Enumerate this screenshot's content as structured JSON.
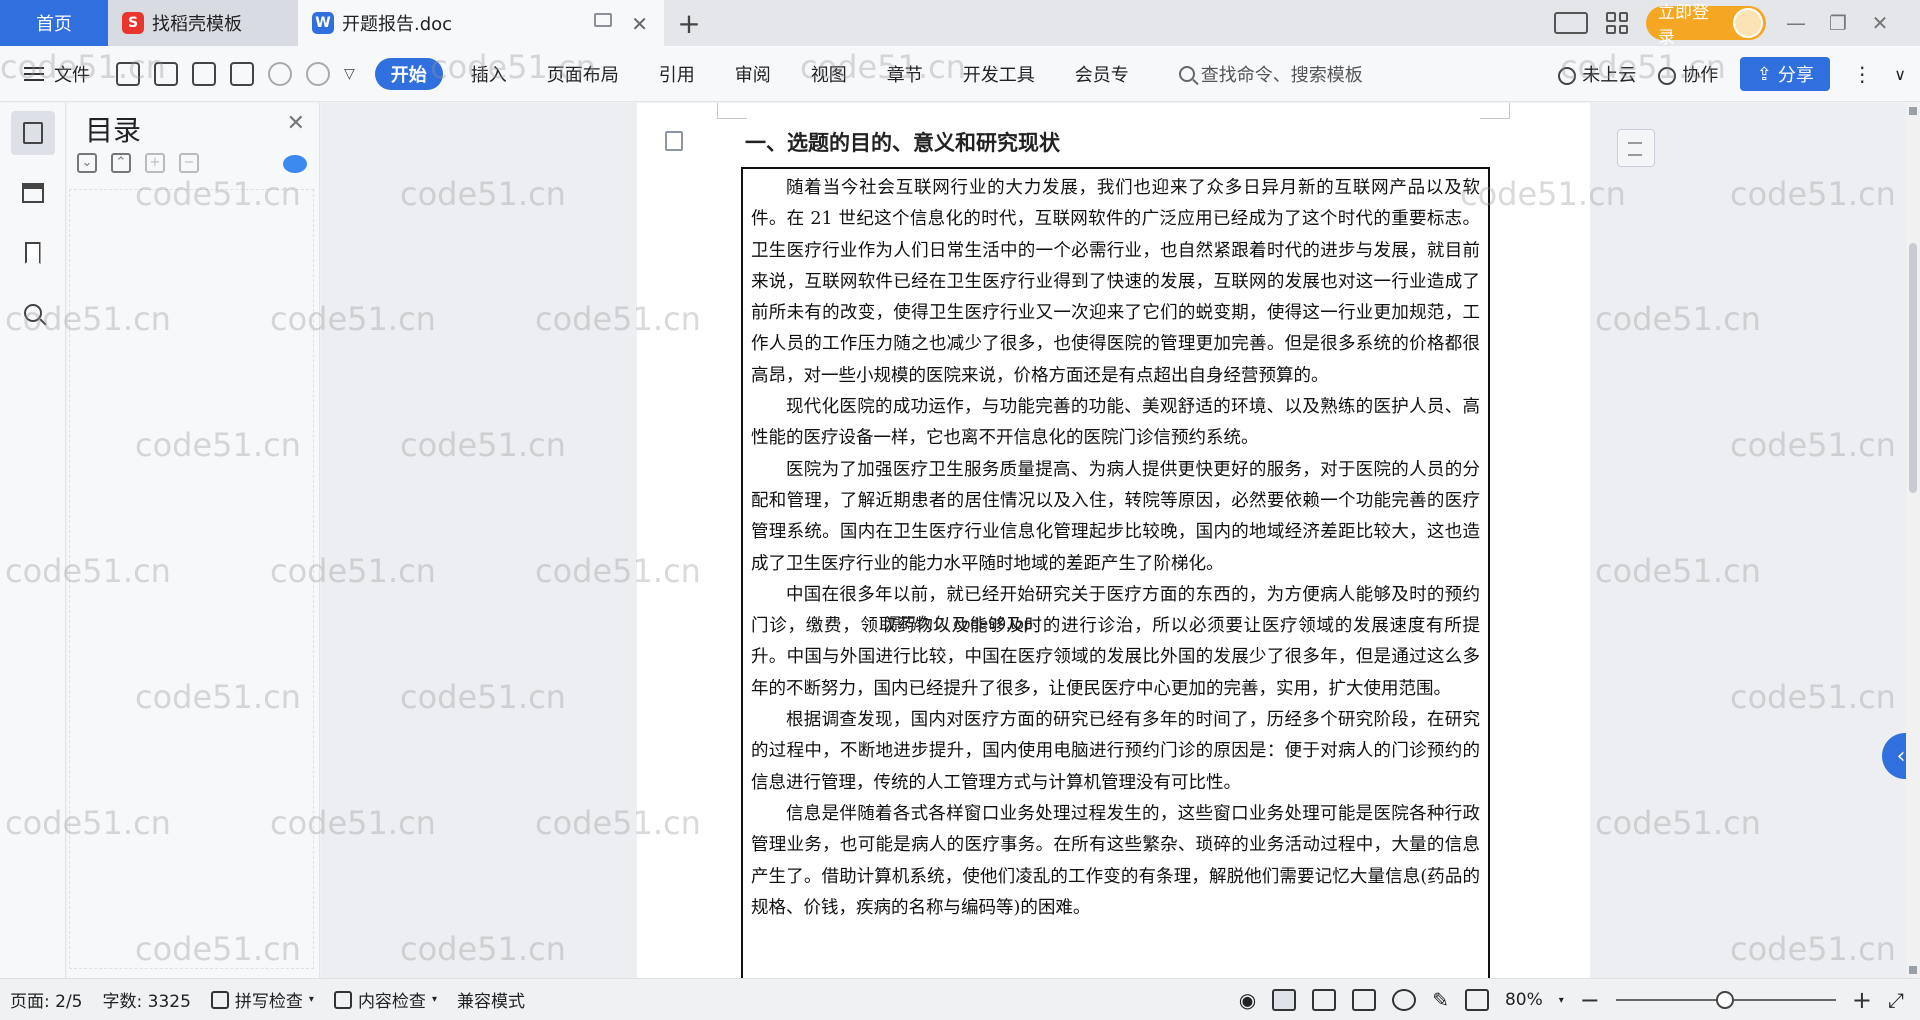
{
  "tabs": {
    "home": "首页",
    "templates": "找稻壳模板",
    "document": "开题报告.doc",
    "login": "立即登录"
  },
  "menu": {
    "file": "文件",
    "ribbon": [
      "开始",
      "插入",
      "页面布局",
      "引用",
      "审阅",
      "视图",
      "章节",
      "开发工具",
      "会员专"
    ],
    "search_placeholder": "查找命令、搜索模板",
    "cloud": "未上云",
    "collab": "协作",
    "share": "分享"
  },
  "toc": {
    "title": "目录"
  },
  "document": {
    "heading": "一、选题的目的、意义和研究现状",
    "paragraphs": [
      "随着当今社会互联网行业的大力发展，我们也迎来了众多日异月新的互联网产品以及软件。在 21 世纪这个信息化的时代，互联网软件的广泛应用已经成为了这个时代的重要标志。卫生医疗行业作为人们日常生活中的一个必需行业，也自然紧跟着时代的进步与发展，就目前来说，互联网软件已经在卫生医疗行业得到了快速的发展，互联网的发展也对这一行业造成了前所未有的改变，使得卫生医疗行业又一次迎来了它们的蜕变期，使得这一行业更加规范，工作人员的工作压力随之也减少了很多，也使得医院的管理更加完善。但是很多系统的价格都很高昂，对一些小规模的医院来说，价格方面还是有点超出自身经营预算的。",
      "现代化医院的成功运作，与功能完善的功能、美观舒适的环境、以及熟练的医护人员、高性能的医疗设备一样，它也离不开信息化的医院门诊信预约系统。",
      "医院为了加强医疗卫生服务质量提高、为病人提供更快更好的服务，对于医院的人员的分配和管理，了解近期患者的居住情况以及入住，转院等原因，必然要依赖一个功能完善的医疗管理系统。国内在卫生医疗行业信息化管理起步比较晚，国内的地域经济差距比较大，这也造成了卫生医疗行业的能力水平随时地域的差距产生了阶梯化。",
      "中国在很多年以前，就已经开始研究关于医疗方面的东西的，为方便病人能够及时的预约门诊，缴费，领取药物以及能够及时的进行诊治，所以必须要让医疗领域的发展速度有所提升。中国与外国进行比较，中国在医疗领域的发展比外国的发展少了很多年，但是通过这么多年的不断努力，国内已经提升了很多，让便民医疗中心更加的完善，实用，扩大使用范围。",
      "根据调查发现，国内对医疗方面的研究已经有多年的时间了，历经多个研究阶段，在研究的过程中，不断地进步提升，国内使用电脑进行预约门诊的原因是：便于对病人的门诊预约的信息进行管理，传统的人工管理方式与计算机管理没有可比性。",
      "信息是伴随着各式各样窗口业务处理过程发生的，这些窗口业务处理可能是医院各种行政管理业务，也可能是病人的医疗事务。在所有这些繁杂、琐碎的业务活动过程中，大量的信息产生了。借助计算机系统，使他们凌乱的工作变的有条理，解脱他们需要记忆大量信息(药品的规格、价钱，疾病的名称与编码等)的困难。"
    ],
    "inline_watermark": "源码久久 code99.top",
    "watermark_text": "code51.cn"
  },
  "status": {
    "page": "页面: 2/5",
    "words": "字数: 3325",
    "spell": "拼写检查",
    "content_check": "内容检查",
    "compat": "兼容模式",
    "zoom": "80%"
  },
  "colors": {
    "accent": "#2f6fde",
    "login": "#f5a623"
  }
}
